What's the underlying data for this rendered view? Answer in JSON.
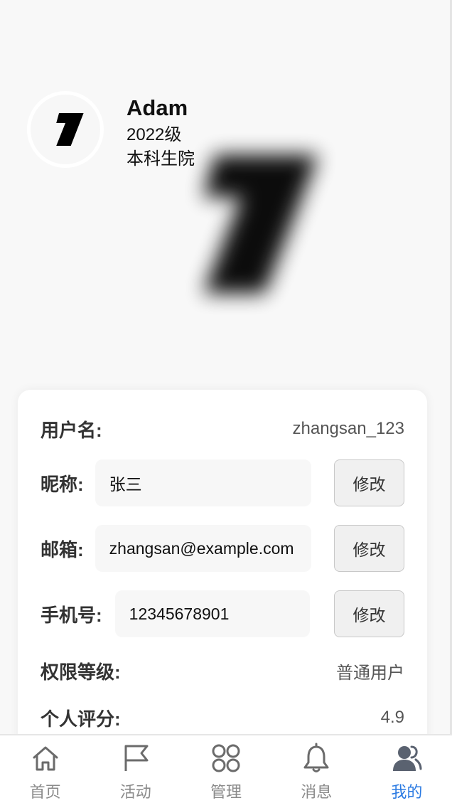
{
  "profile": {
    "name": "Adam",
    "grade": "2022级",
    "college": "本科生院"
  },
  "info": {
    "username_label": "用户名:",
    "username_value": "zhangsan_123",
    "nickname_label": "昵称:",
    "nickname_value": "张三",
    "email_label": "邮箱:",
    "email_value": "zhangsan@example.com",
    "phone_label": "手机号:",
    "phone_value": "12345678901",
    "edit_label": "修改",
    "permission_label": "权限等级:",
    "permission_value": "普通用户",
    "rating_label": "个人评分:",
    "rating_value": "4.9"
  },
  "tabbar": {
    "items": [
      {
        "label": "首页",
        "icon": "home-icon"
      },
      {
        "label": "活动",
        "icon": "flag-icon"
      },
      {
        "label": "管理",
        "icon": "grid-icon"
      },
      {
        "label": "消息",
        "icon": "bell-icon"
      },
      {
        "label": "我的",
        "icon": "users-icon"
      }
    ],
    "active_index": 4,
    "active_color": "#2a7ae2",
    "inactive_color": "#8a8a8a"
  }
}
